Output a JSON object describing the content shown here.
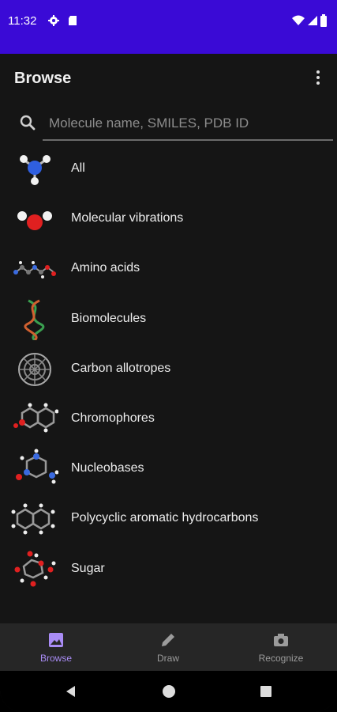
{
  "status_bar": {
    "time": "11:32"
  },
  "toolbar": {
    "title": "Browse"
  },
  "search": {
    "placeholder": "Molecule name, SMILES, PDB ID"
  },
  "categories": [
    {
      "label": "All"
    },
    {
      "label": "Molecular vibrations"
    },
    {
      "label": "Amino acids"
    },
    {
      "label": "Biomolecules"
    },
    {
      "label": "Carbon allotropes"
    },
    {
      "label": "Chromophores"
    },
    {
      "label": "Nucleobases"
    },
    {
      "label": "Polycyclic aromatic hydrocarbons"
    },
    {
      "label": "Sugar"
    }
  ],
  "bottom_nav": {
    "items": [
      {
        "label": "Browse",
        "icon": "image-icon",
        "active": true
      },
      {
        "label": "Draw",
        "icon": "pencil-icon",
        "active": false
      },
      {
        "label": "Recognize",
        "icon": "camera-icon",
        "active": false
      }
    ]
  },
  "colors": {
    "status_bar": "#3a0ad6",
    "background": "#151515",
    "accent": "#a98cf5"
  }
}
